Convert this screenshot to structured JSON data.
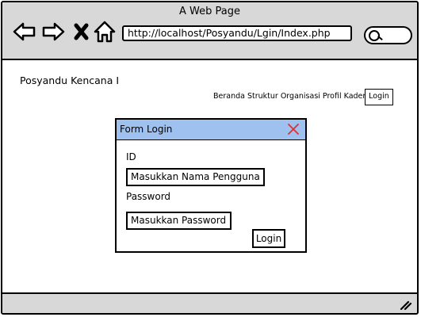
{
  "window": {
    "title": "A Web Page"
  },
  "browser": {
    "url": "http://localhost/Posyandu/Lgin/Index.php",
    "icons": [
      "back-arrow-icon",
      "forward-arrow-icon",
      "close-x-icon",
      "home-icon",
      "search-icon",
      "resize-grip-icon"
    ]
  },
  "site": {
    "title": "Posyandu Kencana I",
    "nav": [
      "Beranda",
      "Struktur Organisasi",
      "Profil Kader"
    ],
    "login_label": "Login"
  },
  "dialog": {
    "title": "Form Login",
    "id_label": "ID",
    "id_value": "Masukkan Nama Pengguna",
    "password_label": "Password",
    "password_value": "Masukkan Password",
    "submit_label": "Login",
    "header_color": "#9ec1f0",
    "close_icon_color": "#e03030"
  }
}
